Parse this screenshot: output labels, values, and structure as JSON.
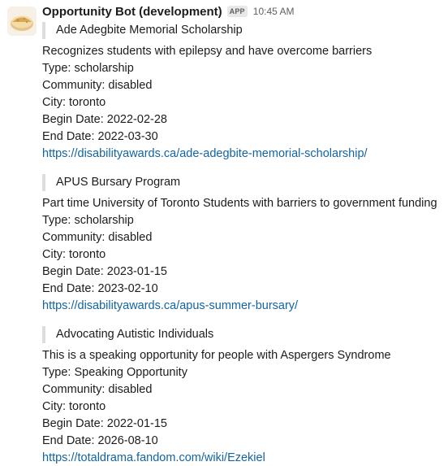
{
  "header": {
    "sender": "Opportunity Bot (development)",
    "badge": "APP",
    "time": "10:45 AM"
  },
  "opportunities": [
    {
      "title": "Ade Adegbite Memorial Scholarship",
      "description": "Recognizes students with epilepsy and have overcome barriers",
      "type": "Type: scholarship",
      "community": "Community: disabled",
      "city": "City: toronto",
      "begin": "Begin Date: 2022-02-28",
      "end": "End Date: 2022-03-30",
      "link": "https://disabilityawards.ca/ade-adegbite-memorial-scholarship/"
    },
    {
      "title": "APUS Bursary Program",
      "description": "Part time University of Toronto Students with barriers to government funding",
      "type": "Type: scholarship",
      "community": "Community: disabled",
      "city": "City: toronto",
      "begin": "Begin Date: 2023-01-15",
      "end": "End Date: 2023-02-10",
      "link": "https://disabilityawards.ca/apus-summer-bursary/"
    },
    {
      "title": "Advocating Autistic Individuals",
      "description": "This is a speaking opportunity for people with Aspergers Syndrome",
      "type": "Type: Speaking Opportunity",
      "community": "Community: disabled",
      "city": "City: toronto",
      "begin": "Begin Date: 2022-01-15",
      "end": "End Date: 2026-08-10",
      "link": "https://totaldrama.fandom.com/wiki/Ezekiel"
    }
  ],
  "colors": {
    "link": "#1264a3",
    "text": "#1d1c1d",
    "muted": "#616061",
    "quote_bar": "#dddddd"
  },
  "icons": {
    "avatar": "bot-avatar-icon"
  }
}
